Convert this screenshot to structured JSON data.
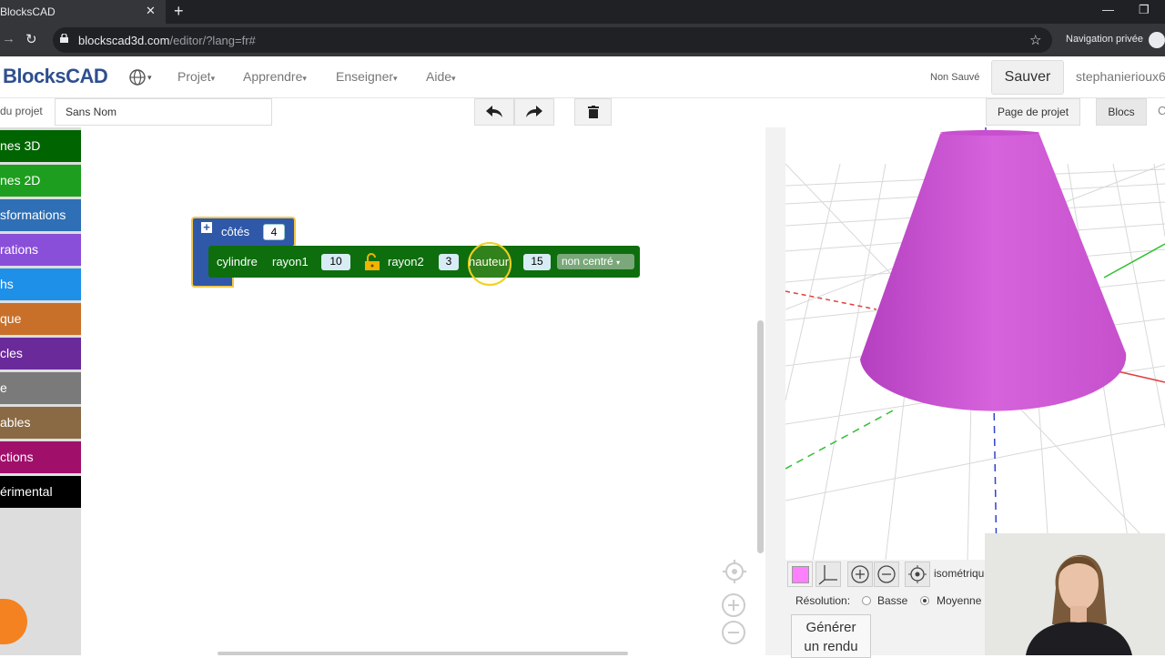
{
  "browser": {
    "tab_title": "BlocksCAD",
    "tab_close": "✕",
    "new_tab": "+",
    "url_host": "blockscad3d.com",
    "url_path": "/editor/?lang=fr#",
    "private_label": "Navigation privée"
  },
  "header": {
    "logo": "BlocksCAD",
    "menu": [
      "Projet",
      "Apprendre",
      "Enseigner",
      "Aide"
    ],
    "save_status": "Non Sauvé",
    "save_button": "Sauver",
    "username": "stephanierioux6"
  },
  "toolbar": {
    "project_label": "du projet",
    "project_name": "Sans Nom",
    "page_projet": "Page de projet",
    "blocs": "Blocs"
  },
  "toolbox": {
    "categories": [
      {
        "label": "nes 3D",
        "color": "#006400"
      },
      {
        "label": "nes 2D",
        "color": "#1e9e1e"
      },
      {
        "label": "sformations",
        "color": "#2f6fb5"
      },
      {
        "label": "rations",
        "color": "#8a4fd8"
      },
      {
        "label": "hs",
        "color": "#1e90e8"
      },
      {
        "label": "que",
        "color": "#c8702a"
      },
      {
        "label": "cles",
        "color": "#6a2a9a"
      },
      {
        "label": "e",
        "color": "#7a7a7a"
      },
      {
        "label": "ables",
        "color": "#8a6a44"
      },
      {
        "label": "ctions",
        "color": "#a0106a"
      },
      {
        "label": "érimental",
        "color": "#000000"
      }
    ]
  },
  "blocks": {
    "outer_label": "côtés",
    "outer_value": "4",
    "cylinder_label": "cylindre",
    "rayon1_label": "rayon1",
    "rayon1_value": "10",
    "rayon2_label": "rayon2",
    "rayon2_value": "3",
    "hauteur_label": "hauteur",
    "hauteur_value": "15",
    "center_option": "non centré"
  },
  "viewer": {
    "view_mode": "isométrique",
    "resolution_label": "Résolution:",
    "resolution_options": [
      "Basse",
      "Moyenne"
    ],
    "selected_resolution": "Moyenne",
    "render_button_line1": "Générer",
    "render_button_line2": "un rendu",
    "object_color": "#ff80ff"
  }
}
